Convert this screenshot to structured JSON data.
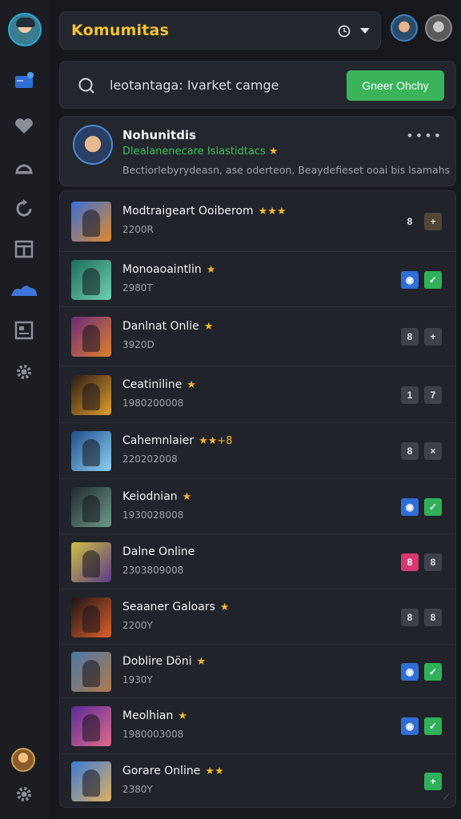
{
  "header": {
    "title": "Komumitas"
  },
  "search": {
    "text": "leotantaga: Ivarket camge",
    "button_label": "Gneer Ohchy"
  },
  "profile": {
    "name": "Nohunitdis",
    "status": "Dlealanenecare Islastidtacs",
    "star": "★",
    "bio": "Bectiorlebyrydeasn, ase oderteon, Beaydefieset ooai bis lsamahs",
    "more": "••••"
  },
  "colors": {
    "accent_yellow": "#f2c230",
    "cta_green": "#3bb35a",
    "status_green": "#3cc25b",
    "blue_badge": "#2f6ed6",
    "pink_badge": "#d7386f"
  },
  "friends": [
    {
      "name": "Modtraigeart Ooiberom",
      "stars": "★★★",
      "sub": "2200R",
      "btn1": {
        "label": "8",
        "style": "plain"
      },
      "btn2": {
        "label": "+",
        "style": "brown"
      }
    },
    {
      "name": "Monoaoaintlin",
      "stars": "★",
      "sub": "2980T",
      "btn1": {
        "label": "◉",
        "style": "blue"
      },
      "btn2": {
        "label": "✓",
        "style": "green"
      }
    },
    {
      "name": "Danlnat Onlie",
      "stars": "★",
      "sub": "3920D",
      "btn1": {
        "label": "8",
        "style": "gray"
      },
      "btn2": {
        "label": "+",
        "style": "gray"
      }
    },
    {
      "name": "Ceatiniline",
      "stars": "★",
      "sub": "1980200008",
      "btn1": {
        "label": "1",
        "style": "gray"
      },
      "btn2": {
        "label": "7",
        "style": "gray"
      }
    },
    {
      "name": "Cahemnlaier",
      "stars": "★★+8",
      "sub": "220202008",
      "btn1": {
        "label": "8",
        "style": "gray"
      },
      "btn2": {
        "label": "×",
        "style": "gray"
      }
    },
    {
      "name": "Keiodnian",
      "stars": "★",
      "sub": "1930028008",
      "btn1": {
        "label": "◉",
        "style": "blue"
      },
      "btn2": {
        "label": "✓",
        "style": "green"
      }
    },
    {
      "name": "Dalne Online",
      "stars": "",
      "sub": "2303809008",
      "btn1": {
        "label": "8",
        "style": "pink"
      },
      "btn2": {
        "label": "8",
        "style": "gray"
      }
    },
    {
      "name": "Seaaner Galoars",
      "stars": "★",
      "sub": "2200Y",
      "btn1": {
        "label": "8",
        "style": "gray"
      },
      "btn2": {
        "label": "8",
        "style": "gray"
      }
    },
    {
      "name": "Doblire Döni",
      "stars": "★",
      "sub": "1930Y",
      "btn1": {
        "label": "◉",
        "style": "blue"
      },
      "btn2": {
        "label": "✓",
        "style": "green"
      }
    },
    {
      "name": "Meolhian",
      "stars": "★",
      "sub": "1980003008",
      "btn1": {
        "label": "◉",
        "style": "blue"
      },
      "btn2": {
        "label": "✓",
        "style": "green"
      }
    },
    {
      "name": "Gorare Online",
      "stars": "★★",
      "sub": "2380Y",
      "btn1": null,
      "btn2": {
        "label": "+",
        "style": "green"
      }
    }
  ]
}
